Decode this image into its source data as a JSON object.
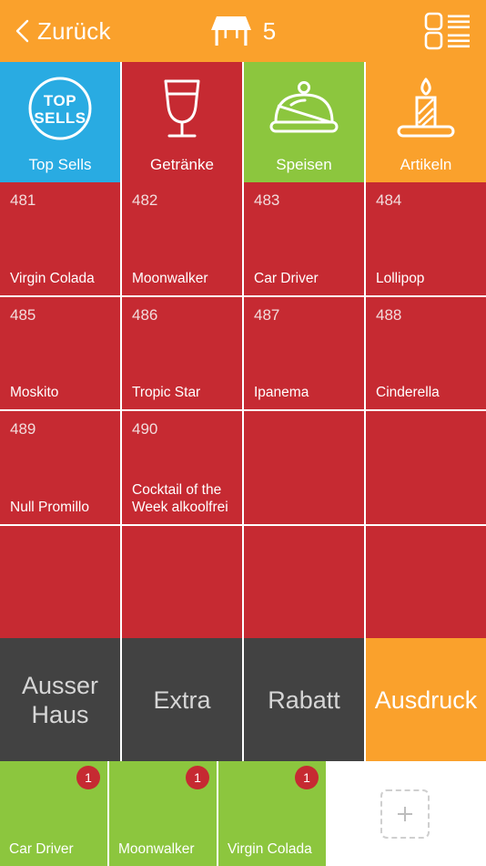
{
  "header": {
    "back_label": "Zurück",
    "back_icon": "chevron-left-icon",
    "table_icon": "table-icon",
    "table_number": "5",
    "listview_icon": "list-view-icon"
  },
  "tabs": [
    {
      "label": "Top Sells",
      "icon": "top-sells-badge-icon",
      "color": "#29abe2",
      "badge_top": "TOP",
      "badge_bottom": "SELLS"
    },
    {
      "label": "Getränke",
      "icon": "wine-glass-icon",
      "color": "#c62a32"
    },
    {
      "label": "Speisen",
      "icon": "cloche-icon",
      "color": "#8cc63e"
    },
    {
      "label": "Artikeln",
      "icon": "candle-icon",
      "color": "#faa12c"
    }
  ],
  "grid": {
    "color": "#c62a32",
    "columns": 4,
    "rows": 4,
    "items": [
      {
        "number": "481",
        "name": "Virgin Colada"
      },
      {
        "number": "482",
        "name": "Moonwalker"
      },
      {
        "number": "483",
        "name": "Car Driver"
      },
      {
        "number": "484",
        "name": "Lollipop"
      },
      {
        "number": "485",
        "name": "Moskito"
      },
      {
        "number": "486",
        "name": "Tropic Star"
      },
      {
        "number": "487",
        "name": "Ipanema"
      },
      {
        "number": "488",
        "name": "Cinderella"
      },
      {
        "number": "489",
        "name": "Null Promillo"
      },
      {
        "number": "490",
        "name": "Cocktail of the Week alkoolfrei"
      },
      {
        "number": "",
        "name": ""
      },
      {
        "number": "",
        "name": ""
      },
      {
        "number": "",
        "name": ""
      },
      {
        "number": "",
        "name": ""
      },
      {
        "number": "",
        "name": ""
      },
      {
        "number": "",
        "name": ""
      }
    ]
  },
  "functions": [
    {
      "label": "Ausser Haus",
      "accent": false
    },
    {
      "label": "Extra",
      "accent": false
    },
    {
      "label": "Rabatt",
      "accent": false
    },
    {
      "label": "Ausdruck",
      "accent": true
    }
  ],
  "cart": {
    "color": "#8cc63e",
    "badge_color": "#c62a32",
    "items": [
      {
        "name": "Car Driver",
        "qty": "1"
      },
      {
        "name": "Moonwalker",
        "qty": "1"
      },
      {
        "name": "Virgin Colada",
        "qty": "1"
      }
    ],
    "empty_slots": [
      {
        "icon": "plus-icon"
      },
      {
        "icon": "plus-icon"
      }
    ]
  }
}
